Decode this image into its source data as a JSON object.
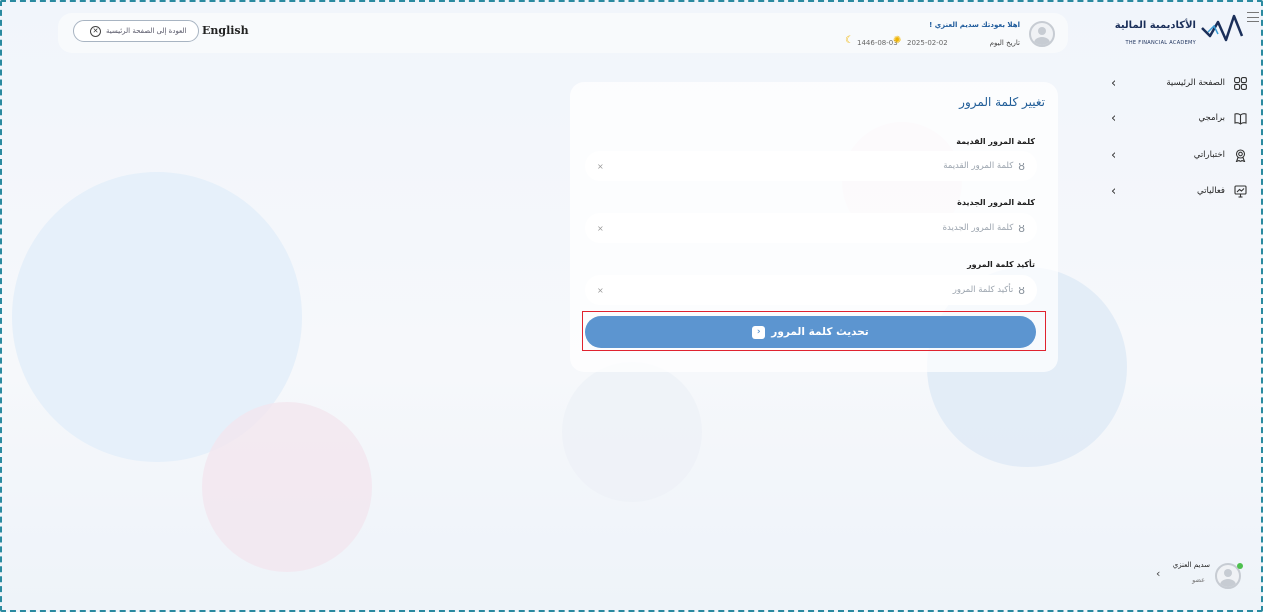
{
  "header": {
    "language_label": "English",
    "back_label": "العودة إلى الصفحة الرئيسية",
    "greeting": "اهلا بعودتك سديم العنزي !",
    "date_label": "تاريخ اليوم",
    "gregorian_date": "2025-02-02",
    "hijri_date": "1446-08-03"
  },
  "logo": {
    "arabic": "الأكاديمية المالية",
    "english": "THE FINANCIAL ACADEMY"
  },
  "sidebar": {
    "items": [
      {
        "label": "الصفحة الرئيسية",
        "icon": "grid-icon"
      },
      {
        "label": "برامجي",
        "icon": "book-icon"
      },
      {
        "label": "اختباراتي",
        "icon": "award-icon"
      },
      {
        "label": "فعالياتي",
        "icon": "presentation-icon"
      }
    ]
  },
  "profile": {
    "name": "سديم العنزي",
    "role": "عضو"
  },
  "form": {
    "title": "تغيير كلمة المرور",
    "old_password": {
      "label": "كلمة المرور القديمة",
      "placeholder": "كلمة المرور القديمة"
    },
    "new_password": {
      "label": "كلمة المرور الجديدة",
      "placeholder": "كلمة المرور الجديدة"
    },
    "confirm_password": {
      "label": "تأكيد كلمة المرور",
      "placeholder": "تأكيد كلمة المرور"
    },
    "clear_symbol": "×",
    "submit_label": "تحديث كلمة المرور"
  },
  "colors": {
    "accent": "#5c95d0",
    "title": "#1f5c97",
    "highlight": "#e0232f",
    "frame": "#2a8aa0"
  }
}
